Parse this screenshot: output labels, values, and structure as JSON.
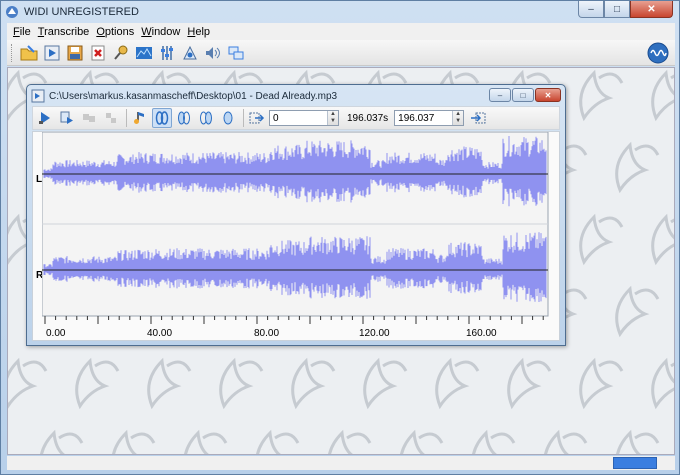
{
  "app": {
    "title": "WIDI UNREGISTERED",
    "window_controls": [
      "–",
      "□",
      "✕"
    ]
  },
  "menu": [
    "File",
    "Transcribe",
    "Options",
    "Window",
    "Help"
  ],
  "toolbar_icons": [
    "open-folder-icon",
    "open-audio-icon",
    "save-icon",
    "close-file-icon",
    "microphone-icon",
    "spectrum-icon",
    "equalizer-icon",
    "recognize-icon",
    "speaker-icon",
    "tile-windows-icon"
  ],
  "child": {
    "title": "C:\\Users\\markus.kasanmascheff\\Desktop\\01 - Dead Already.mp3",
    "start_value": "0",
    "duration_text": "196.037s",
    "end_value": "196.037"
  },
  "channels": {
    "left": "L",
    "right": "R"
  },
  "axis": {
    "ticks": [
      "0.00",
      "40.00",
      "80.00",
      "120.00",
      "160.00"
    ]
  },
  "colors": {
    "waveform": "#8f92f0",
    "accent": "#3a7ee0"
  }
}
